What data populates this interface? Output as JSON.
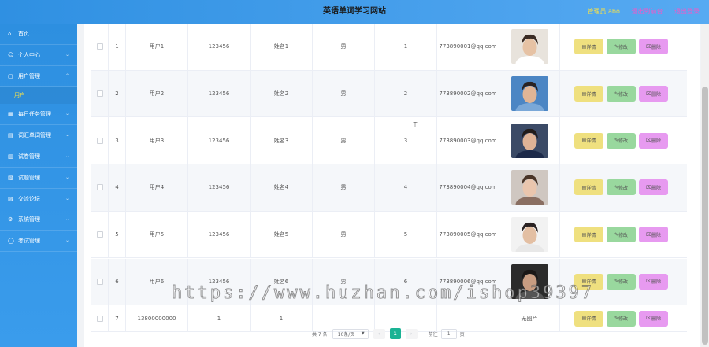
{
  "header": {
    "title": "英语单词学习网站",
    "admin_label": "管理员 abo",
    "back_label": "退出到前台",
    "logout_label": "退出登录"
  },
  "sidebar": {
    "items": [
      {
        "icon": "home-icon",
        "label": "首页"
      },
      {
        "icon": "user-icon",
        "label": "个人中心"
      },
      {
        "icon": "users-icon",
        "label": "用户管理"
      },
      {
        "icon": "calendar-icon",
        "label": "每日任务管理"
      },
      {
        "icon": "book-icon",
        "label": "词汇单词管理"
      },
      {
        "icon": "paper-icon",
        "label": "试卷管理"
      },
      {
        "icon": "question-icon",
        "label": "试题管理"
      },
      {
        "icon": "forum-icon",
        "label": "交流论坛"
      },
      {
        "icon": "gear-icon",
        "label": "系统管理"
      },
      {
        "icon": "exam-icon",
        "label": "考试管理"
      }
    ],
    "sub_item": "用户"
  },
  "table": {
    "rows": [
      {
        "idx": "1",
        "account": "用户1",
        "password": "123456",
        "name": "姓名1",
        "gender": "男",
        "age": "1",
        "email": "773890001@qq.com",
        "photo": "avatar-1",
        "photo_text": ""
      },
      {
        "idx": "2",
        "account": "用户2",
        "password": "123456",
        "name": "姓名2",
        "gender": "男",
        "age": "2",
        "email": "773890002@qq.com",
        "photo": "avatar-2",
        "photo_text": ""
      },
      {
        "idx": "3",
        "account": "用户3",
        "password": "123456",
        "name": "姓名3",
        "gender": "男",
        "age": "3",
        "email": "773890003@qq.com",
        "photo": "avatar-3",
        "photo_text": ""
      },
      {
        "idx": "4",
        "account": "用户4",
        "password": "123456",
        "name": "姓名4",
        "gender": "男",
        "age": "4",
        "email": "773890004@qq.com",
        "photo": "avatar-4",
        "photo_text": ""
      },
      {
        "idx": "5",
        "account": "用户5",
        "password": "123456",
        "name": "姓名5",
        "gender": "男",
        "age": "5",
        "email": "773890005@qq.com",
        "photo": "avatar-5",
        "photo_text": ""
      },
      {
        "idx": "6",
        "account": "用户6",
        "password": "123456",
        "name": "姓名6",
        "gender": "男",
        "age": "6",
        "email": "773890006@qq.com",
        "photo": "avatar-6",
        "photo_text": ""
      },
      {
        "idx": "7",
        "account": "13800000000",
        "password": "1",
        "name": "1",
        "gender": "",
        "age": "",
        "email": "",
        "photo": "",
        "photo_text": "无图片"
      }
    ],
    "actions": {
      "detail": "详情",
      "edit": "修改",
      "delete": "删除"
    }
  },
  "pager": {
    "total": "共 7 条",
    "page_size": "10条/页",
    "current": "1",
    "goto_prefix": "前往",
    "goto_value": "1",
    "goto_suffix": "页"
  },
  "watermark": "https://www.huzhan.com/ishop39397",
  "colors": {
    "header_blue": "#2f90e2",
    "detail_btn": "#efe07f",
    "edit_btn": "#99d89e",
    "delete_btn": "#e79af0",
    "pager_active": "#1ab394"
  }
}
